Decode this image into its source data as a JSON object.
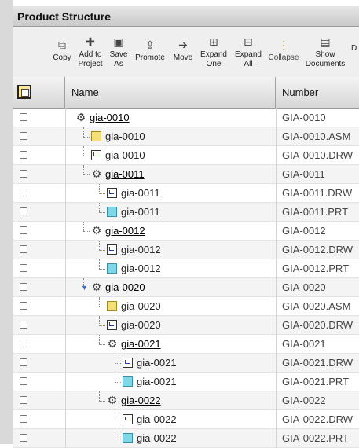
{
  "panel": {
    "title": "Product Structure"
  },
  "toolbar": {
    "buttons": [
      {
        "label": "Copy",
        "icon": "copy-icon"
      },
      {
        "label": "Add to Project",
        "icon": "add-to-project-icon"
      },
      {
        "label": "Save As",
        "icon": "save-as-icon"
      },
      {
        "label": "Promote",
        "icon": "promote-icon"
      },
      {
        "label": "Move",
        "icon": "move-icon"
      },
      {
        "label": "Expand One",
        "icon": "expand-one-icon"
      },
      {
        "label": "Expand All",
        "icon": "expand-all-icon"
      },
      {
        "label": "Collapse",
        "icon": "collapse-icon"
      },
      {
        "label": "Show Documents",
        "icon": "show-documents-icon"
      },
      {
        "label": "D",
        "icon": "more-icon"
      }
    ]
  },
  "table": {
    "columns": {
      "name": "Name",
      "number": "Number"
    },
    "rows": [
      {
        "name": "gia-0010",
        "number": "GIA-0010",
        "type": "product",
        "level": 0,
        "underline": true
      },
      {
        "name": "gia-0010",
        "number": "GIA-0010.ASM",
        "type": "asm",
        "level": 1,
        "underline": false
      },
      {
        "name": "gia-0010",
        "number": "GIA-0010.DRW",
        "type": "drw",
        "level": 1,
        "underline": false
      },
      {
        "name": "gia-0011",
        "number": "GIA-0011",
        "type": "product",
        "level": 1,
        "underline": true
      },
      {
        "name": "gia-0011",
        "number": "GIA-0011.DRW",
        "type": "drw",
        "level": 2,
        "underline": false
      },
      {
        "name": "gia-0011",
        "number": "GIA-0011.PRT",
        "type": "part",
        "level": 2,
        "underline": false
      },
      {
        "name": "gia-0012",
        "number": "GIA-0012",
        "type": "product",
        "level": 1,
        "underline": true
      },
      {
        "name": "gia-0012",
        "number": "GIA-0012.DRW",
        "type": "drw",
        "level": 2,
        "underline": false
      },
      {
        "name": "gia-0012",
        "number": "GIA-0012.PRT",
        "type": "part",
        "level": 2,
        "underline": false
      },
      {
        "name": "gia-0020",
        "number": "GIA-0020",
        "type": "product",
        "level": 1,
        "underline": true,
        "expanded": true
      },
      {
        "name": "gia-0020",
        "number": "GIA-0020.ASM",
        "type": "asm",
        "level": 2,
        "underline": false
      },
      {
        "name": "gia-0020",
        "number": "GIA-0020.DRW",
        "type": "drw",
        "level": 2,
        "underline": false
      },
      {
        "name": "gia-0021",
        "number": "GIA-0021",
        "type": "product",
        "level": 2,
        "underline": true
      },
      {
        "name": "gia-0021",
        "number": "GIA-0021.DRW",
        "type": "drw",
        "level": 3,
        "underline": false
      },
      {
        "name": "gia-0021",
        "number": "GIA-0021.PRT",
        "type": "part",
        "level": 3,
        "underline": false
      },
      {
        "name": "gia-0022",
        "number": "GIA-0022",
        "type": "product",
        "level": 2,
        "underline": true
      },
      {
        "name": "gia-0022",
        "number": "GIA-0022.DRW",
        "type": "drw",
        "level": 3,
        "underline": false
      },
      {
        "name": "gia-0022",
        "number": "GIA-0022.PRT",
        "type": "part",
        "level": 3,
        "underline": false
      }
    ]
  }
}
